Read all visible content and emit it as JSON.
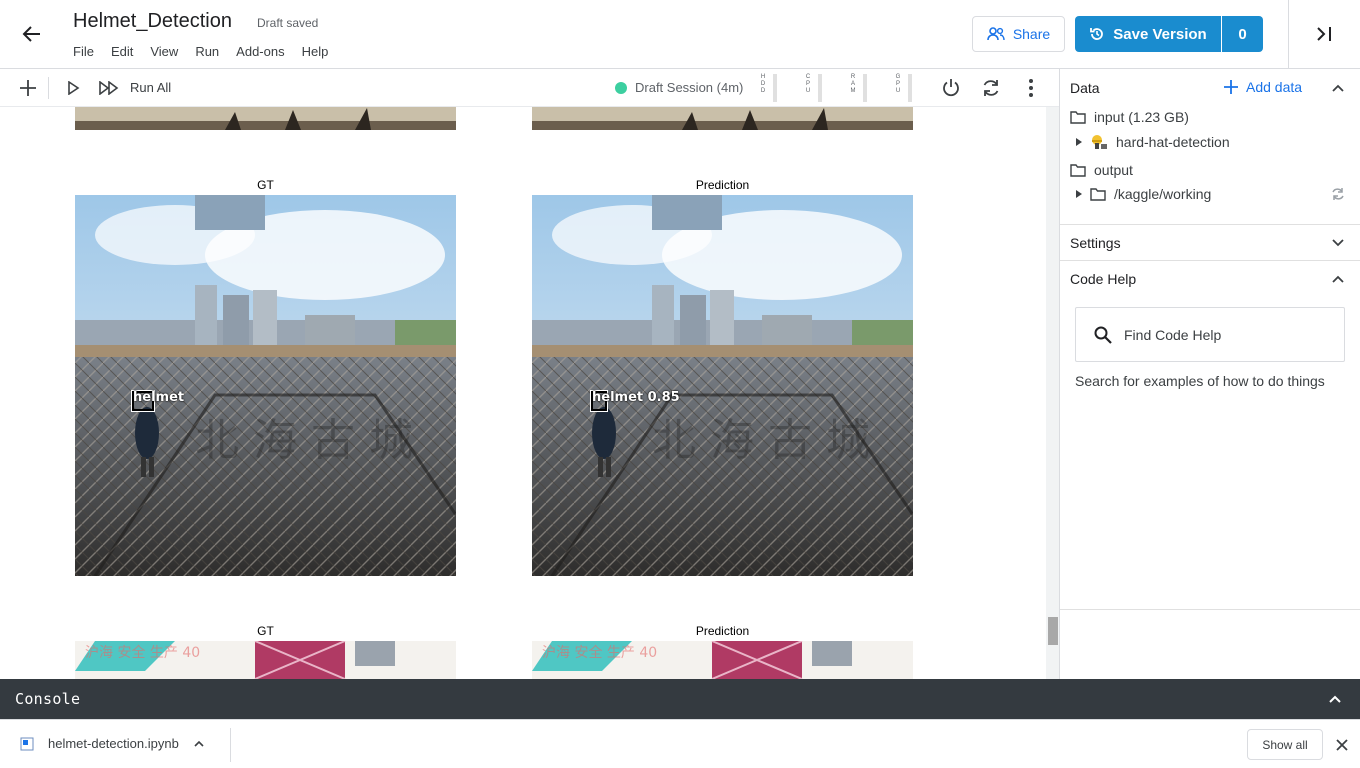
{
  "header": {
    "title": "Helmet_Detection",
    "status": "Draft saved",
    "menu": [
      "File",
      "Edit",
      "View",
      "Run",
      "Add-ons",
      "Help"
    ],
    "share_label": "Share",
    "save_label": "Save Version",
    "save_count": "0"
  },
  "toolbar": {
    "run_all_label": "Run All",
    "session_label": "Draft Session (4m)",
    "meters": [
      "HDD",
      "CPU",
      "RAM",
      "GPU"
    ],
    "colors": {
      "session_dot": "#3ccfa0"
    }
  },
  "notebook": {
    "figures": [
      {
        "gt_label": "GT",
        "pred_label": "Prediction",
        "gt_box_text": "helmet",
        "pred_box_text": "helmet 0.85"
      },
      {
        "gt_label": "GT",
        "pred_label": "Prediction"
      }
    ]
  },
  "right_panel": {
    "data_title": "Data",
    "add_data_label": "Add data",
    "input_label": "input (1.23 GB)",
    "input_child": "hard-hat-detection",
    "output_label": "output",
    "output_child": "/kaggle/working",
    "settings_title": "Settings",
    "code_help_title": "Code Help",
    "find_placeholder": "Find Code Help",
    "find_hint": "Search for examples of how to do things"
  },
  "console": {
    "title": "Console"
  },
  "downloads": {
    "file_name": "helmet-detection.ipynb",
    "show_all_label": "Show all"
  },
  "colors": {
    "accent": "#1a8ccf",
    "console_bg": "#343a40"
  }
}
